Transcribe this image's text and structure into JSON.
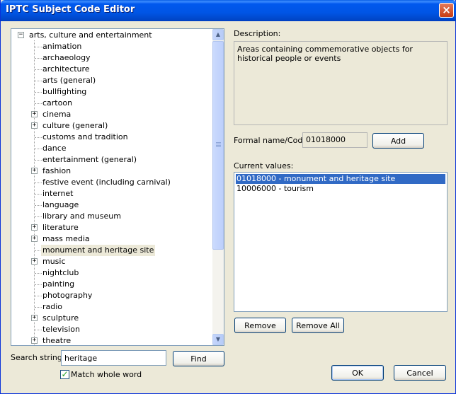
{
  "window": {
    "title": "IPTC Subject Code Editor",
    "close_glyph": "×"
  },
  "tree": {
    "root": {
      "label": "arts, culture and entertainment",
      "expander": "−"
    },
    "items": [
      {
        "label": "animation",
        "expandable": false,
        "selected": false
      },
      {
        "label": "archaeology",
        "expandable": false,
        "selected": false
      },
      {
        "label": "architecture",
        "expandable": false,
        "selected": false
      },
      {
        "label": "arts (general)",
        "expandable": false,
        "selected": false
      },
      {
        "label": "bullfighting",
        "expandable": false,
        "selected": false
      },
      {
        "label": "cartoon",
        "expandable": false,
        "selected": false
      },
      {
        "label": "cinema",
        "expandable": true,
        "selected": false
      },
      {
        "label": "culture (general)",
        "expandable": true,
        "selected": false
      },
      {
        "label": "customs and tradition",
        "expandable": false,
        "selected": false
      },
      {
        "label": "dance",
        "expandable": false,
        "selected": false
      },
      {
        "label": "entertainment (general)",
        "expandable": false,
        "selected": false
      },
      {
        "label": "fashion",
        "expandable": true,
        "selected": false
      },
      {
        "label": "festive event (including carnival)",
        "expandable": false,
        "selected": false
      },
      {
        "label": "internet",
        "expandable": false,
        "selected": false
      },
      {
        "label": "language",
        "expandable": false,
        "selected": false
      },
      {
        "label": "library and museum",
        "expandable": false,
        "selected": false
      },
      {
        "label": "literature",
        "expandable": true,
        "selected": false
      },
      {
        "label": "mass media",
        "expandable": true,
        "selected": false
      },
      {
        "label": "monument and heritage site",
        "expandable": false,
        "selected": true
      },
      {
        "label": "music",
        "expandable": true,
        "selected": false
      },
      {
        "label": "nightclub",
        "expandable": false,
        "selected": false
      },
      {
        "label": "painting",
        "expandable": false,
        "selected": false
      },
      {
        "label": "photography",
        "expandable": false,
        "selected": false
      },
      {
        "label": "radio",
        "expandable": false,
        "selected": false
      },
      {
        "label": "sculpture",
        "expandable": true,
        "selected": false
      },
      {
        "label": "television",
        "expandable": false,
        "selected": false
      },
      {
        "label": "theatre",
        "expandable": true,
        "selected": false
      }
    ],
    "expander_glyph": "+",
    "scroll_up": "▲",
    "scroll_down": "▼"
  },
  "search": {
    "label": "Search string:",
    "value": "heritage",
    "find_button": "Find",
    "match_whole_word_label": "Match whole word",
    "match_whole_word_checked": true,
    "check_glyph": "✓"
  },
  "description": {
    "label": "Description:",
    "text": "Areas containing commemorative objects for historical people or events"
  },
  "formal": {
    "label": "Formal name/Code:",
    "value": "01018000",
    "add_button": "Add"
  },
  "current_values": {
    "label": "Current values:",
    "items": [
      {
        "text": "01018000 - monument and heritage site",
        "selected": true
      },
      {
        "text": "10006000 - tourism",
        "selected": false
      }
    ],
    "remove_button": "Remove",
    "remove_all_button": "Remove All"
  },
  "footer": {
    "ok_button": "OK",
    "cancel_button": "Cancel"
  }
}
